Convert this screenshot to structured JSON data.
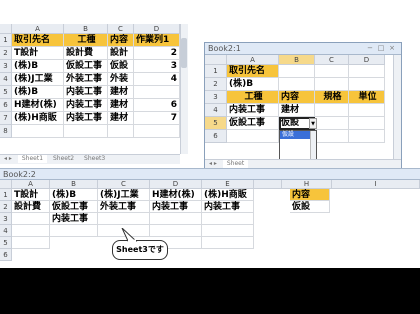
{
  "book1": {
    "columns": [
      "A",
      "B",
      "C",
      "D"
    ],
    "rows": [
      "1",
      "2",
      "3",
      "4",
      "5",
      "6",
      "7",
      "8"
    ],
    "header_cells": [
      "取引先名",
      "工種",
      "内容",
      "作業列1"
    ],
    "data": [
      [
        "T設計",
        "設計費",
        "設計",
        "2"
      ],
      [
        "(株)B",
        "仮設工事",
        "仮設",
        "3"
      ],
      [
        "(株)J工業",
        "外装工事",
        "外装",
        "4"
      ],
      [
        "(株)B",
        "内装工事",
        "建材",
        ""
      ],
      [
        "H建材(株)",
        "内装工事",
        "建材",
        "6"
      ],
      [
        "(株)H商販",
        "内装工事",
        "建材",
        "7"
      ]
    ],
    "tabs": [
      "Sheet1",
      "Sheet2",
      "Sheet3"
    ]
  },
  "book2_1": {
    "title": "Book2:1",
    "columns": [
      "A",
      "B",
      "C",
      "D"
    ],
    "rows": [
      "1",
      "2",
      "3",
      "4",
      "5",
      "6"
    ],
    "a1": "取引先名",
    "a2": "(株)B",
    "headers": [
      "工種",
      "内容",
      "規格",
      "単位"
    ],
    "row4": [
      "内装工事",
      "建材"
    ],
    "row5": [
      "仮設工事",
      "仮設"
    ],
    "dropdown_selected": "仮設",
    "tab": "Sheet"
  },
  "book2_2": {
    "title": "Book2:2",
    "columns": [
      "A",
      "B",
      "C",
      "D",
      "E"
    ],
    "rows": [
      "1",
      "2",
      "3",
      "4",
      "5",
      "6"
    ],
    "headers": [
      "T設計",
      "(株)B",
      "(株)J工業",
      "H建材(株)",
      "(株)H商販"
    ],
    "row2": [
      "設計費",
      "仮設工事",
      "外装工事",
      "内装工事",
      "内装工事"
    ],
    "row3": [
      "",
      "内装工事",
      "",
      "",
      ""
    ],
    "right_columns": [
      "H",
      "I"
    ],
    "right_header": "内容",
    "right_value": "仮設",
    "callout": "Sheet3です"
  },
  "window_buttons": [
    "−",
    "□",
    "×"
  ]
}
